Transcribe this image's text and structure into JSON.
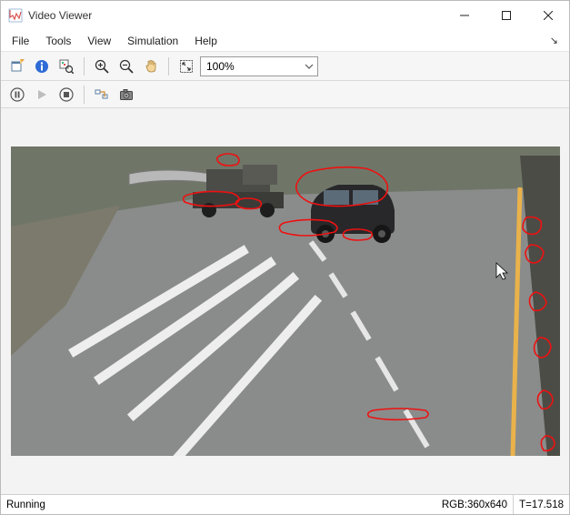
{
  "window": {
    "title": "Video Viewer"
  },
  "menubar": {
    "items": [
      "File",
      "Tools",
      "View",
      "Simulation",
      "Help"
    ],
    "corner_glyph": "↘"
  },
  "toolbar": {
    "zoom_value": "100%"
  },
  "status": {
    "state": "Running",
    "format": "RGB:360x640",
    "time": "T=17.518"
  },
  "icons": {
    "new_viewer": "new-viewer",
    "info": "info",
    "inspect": "inspect-pixel",
    "zoom_in": "zoom-in",
    "zoom_out": "zoom-out",
    "pan": "pan-hand",
    "fit": "fit-to-window",
    "pause": "pause",
    "play": "play",
    "stop": "stop",
    "highlight": "highlight-blocks",
    "snapshot": "snapshot-camera"
  }
}
